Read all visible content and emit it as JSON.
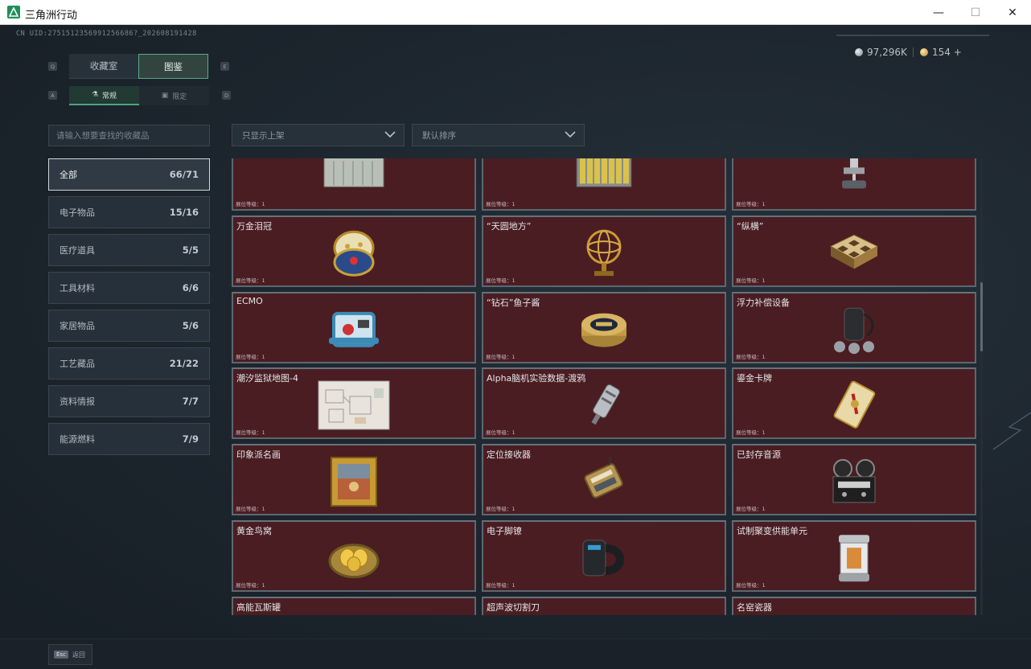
{
  "window": {
    "title": "三角洲行动",
    "min": "—",
    "max": "☐",
    "close": "✕"
  },
  "uid": "CN UID:2751512356991256686?_202608191428",
  "currency": {
    "coins": "97,296K",
    "tickets": "154 +"
  },
  "keys": {
    "prev_tab": "Q",
    "next_tab": "E",
    "prev_sub": "A",
    "next_sub": "D",
    "esc": "Esc"
  },
  "tabs": {
    "collection_room": "收藏室",
    "catalog": "图鉴"
  },
  "subtabs": {
    "regular": "常规",
    "limited": "限定"
  },
  "search_placeholder": "请输入想要查找的收藏品",
  "filters": {
    "shelf": "只显示上架",
    "sort": "默认排序"
  },
  "categories": [
    {
      "label": "全部",
      "count": "66/71",
      "active": true
    },
    {
      "label": "电子物品",
      "count": "15/16"
    },
    {
      "label": "医疗道具",
      "count": "5/5"
    },
    {
      "label": "工具材料",
      "count": "6/6"
    },
    {
      "label": "家居物品",
      "count": "5/6"
    },
    {
      "label": "工艺藏品",
      "count": "21/22"
    },
    {
      "label": "资料情报",
      "count": "7/7"
    },
    {
      "label": "能源燃料",
      "count": "7/9"
    }
  ],
  "level_label": "展位等级：1",
  "items": [
    {
      "name": "",
      "icon": "server-case-icon"
    },
    {
      "name": "",
      "icon": "battery-pack-icon"
    },
    {
      "name": "",
      "icon": "robot-arm-icon"
    },
    {
      "name": "万金泪冠",
      "icon": "jeweled-egg-icon"
    },
    {
      "name": "“天圆地方”",
      "icon": "armillary-sphere-icon"
    },
    {
      "name": "“纵横”",
      "icon": "chess-board-icon"
    },
    {
      "name": "ECMO",
      "icon": "ecmo-machine-icon"
    },
    {
      "name": "“钻石”鱼子酱",
      "icon": "caviar-tin-icon"
    },
    {
      "name": "浮力补偿设备",
      "icon": "diving-gear-icon"
    },
    {
      "name": "潮汐监狱地图-4",
      "icon": "prison-map-icon"
    },
    {
      "name": "Alpha脑机实验数据-渡鸦",
      "icon": "data-flask-icon"
    },
    {
      "name": "鎏金卡牌",
      "icon": "gold-card-icon"
    },
    {
      "name": "印象派名画",
      "icon": "framed-painting-icon"
    },
    {
      "name": "定位接收器",
      "icon": "gps-receiver-icon"
    },
    {
      "name": "已封存音源",
      "icon": "reel-recorder-icon"
    },
    {
      "name": "黄金鸟窝",
      "icon": "golden-nest-icon"
    },
    {
      "name": "电子脚镣",
      "icon": "ankle-monitor-icon"
    },
    {
      "name": "试制聚变供能单元",
      "icon": "fusion-cell-icon"
    },
    {
      "name": "高能瓦斯罐",
      "icon": "gas-canister-icon"
    },
    {
      "name": "超声波切割刀",
      "icon": "ultrasonic-knife-icon"
    },
    {
      "name": "名窑瓷器",
      "icon": "porcelain-vase-icon"
    }
  ],
  "back_label": "返回"
}
